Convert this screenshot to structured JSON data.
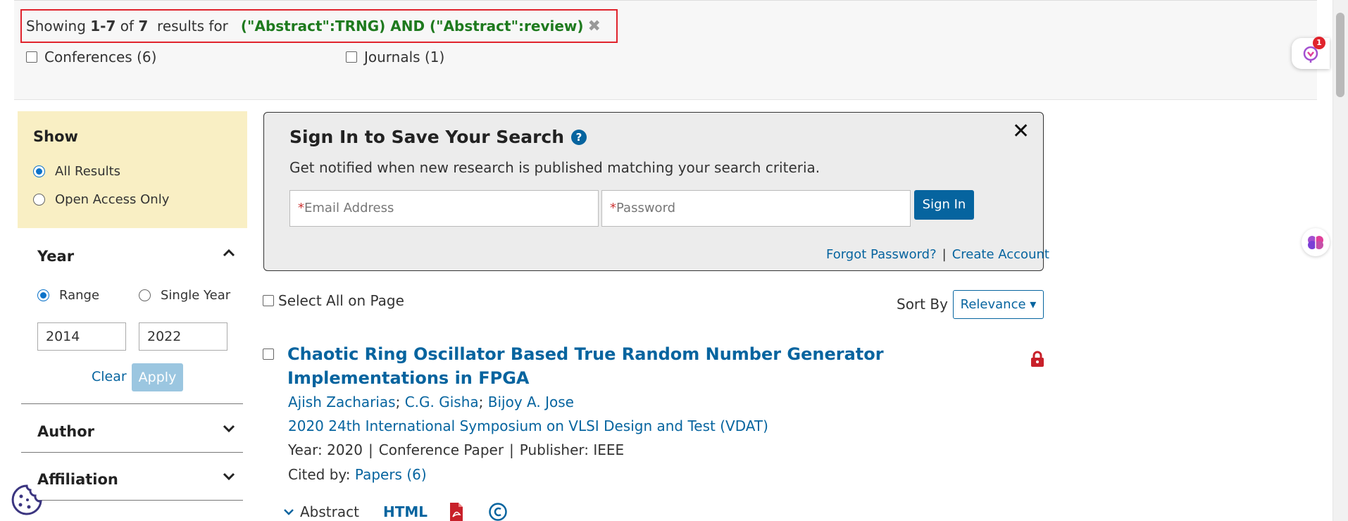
{
  "results_summary": {
    "showing": "Showing",
    "range": "1-7",
    "of": "of",
    "total": "7",
    "results_for": "results for",
    "query": "(\"Abstract\":TRNG) AND (\"Abstract\":review)",
    "clear_glyph": "✖"
  },
  "facets": [
    {
      "label": "Conferences (6)"
    },
    {
      "label": "Journals (1)"
    }
  ],
  "floating": {
    "badge_count": "1"
  },
  "sidebar": {
    "show": {
      "title": "Show",
      "options": [
        {
          "label": "All Results",
          "selected": true
        },
        {
          "label": "Open Access Only",
          "selected": false
        }
      ]
    },
    "year": {
      "title": "Year",
      "range_label": "Range",
      "single_label": "Single Year",
      "from": "2014",
      "to": "2022",
      "clear": "Clear",
      "apply": "Apply"
    },
    "author": {
      "title": "Author"
    },
    "affiliation": {
      "title": "Affiliation"
    }
  },
  "signin_panel": {
    "title": "Sign In to Save Your Search",
    "help_glyph": "?",
    "close_glyph": "✕",
    "subtitle": "Get notified when new research is published matching your search criteria.",
    "required_mark": "*",
    "email_placeholder": "Email Address",
    "password_placeholder": "Password",
    "button": "Sign In",
    "forgot": "Forgot Password?",
    "separator": "|",
    "create": "Create Account"
  },
  "toolbar": {
    "select_all": "Select All on Page",
    "sort_label": "Sort By",
    "sort_value": "Relevance ▾"
  },
  "results": [
    {
      "title": "Chaotic Ring Oscillator Based True Random Number Generator Implementations in FPGA",
      "authors": [
        "Ajish Zacharias",
        "C.G. Gisha",
        "Bijoy A. Jose"
      ],
      "venue": "2020 24th International Symposium on VLSI Design and Test (VDAT)",
      "year_text": "Year: 2020",
      "type": "Conference Paper",
      "publisher_text": "Publisher:  IEEE",
      "cited_label": "Cited by: ",
      "cited_link": "Papers (6)",
      "abstract_label": "Abstract",
      "html_label": "HTML"
    }
  ],
  "colors": {
    "link": "#06649f",
    "query_green": "#1e7a1e",
    "highlight_red": "#e0232c",
    "show_box_bg": "#f9efc4",
    "signin_bg": "#ececec"
  },
  "icons": [
    "clear-x-icon",
    "bell-notification-icon",
    "brain-icon",
    "help-icon",
    "close-icon",
    "chevron-up-icon",
    "chevron-down-icon",
    "lock-icon",
    "pdf-icon",
    "copyright-icon",
    "cookie-icon"
  ]
}
